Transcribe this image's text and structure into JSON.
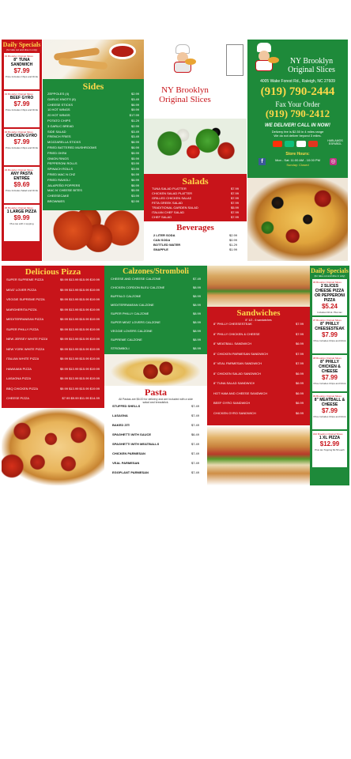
{
  "brand": {
    "name_line1": "NY Brooklyn",
    "name_line2": "Original Slices",
    "address": "4005 Wake Forest Rd., Raleigh, NC 27609",
    "phone": "(919) 790-2444",
    "fax_label": "Fax Your Order",
    "fax": "(919) 790-2412",
    "delivery_title": "WE DELIVER! CALL IN NOW!",
    "delivery_line1": "Delivery fee is $2.50 in 4 miles range",
    "delivery_line2": "We do not deliver beyond 3 miles.",
    "hours_title": "Store Hours:",
    "hours_weekday": "Mon - Sat: 11:00 AM - 10:00 PM",
    "hours_sunday": "Sunday: Closed",
    "spanish": "HABLAMOS ESPAÑOL"
  },
  "daily_specials_left": {
    "title": "Daily Specials",
    "subtitle": "(for take out and dine in only)",
    "items": [
      {
        "tag": "#1 Brooklyn Original Slices",
        "name": "8\" TUNA SANDWICH",
        "price": "$7.99",
        "note": "Price Includes Chips and Drink"
      },
      {
        "tag": "#2 Brooklyn Original Slices",
        "name": "BEEF GYRO",
        "price": "$7.99",
        "note": "Price Includes Chips and Drink"
      },
      {
        "tag": "#3 Brooklyn Original Slices",
        "name": "CHICKEN GYRO",
        "price": "$7.99",
        "note": "Price Includes Chips and Drink"
      },
      {
        "tag": "#4 Brooklyn Original Slices",
        "name": "ANY PASTA ENTRÉE",
        "price": "$9.69",
        "note": "Price Includes Salad and Drink"
      },
      {
        "tag": "#5 Brooklyn Original Slices",
        "name": "1 LARGE PIZZA",
        "price": "$9.99",
        "note": "Plus tax with 1 topping"
      }
    ]
  },
  "daily_specials_right": {
    "title": "Daily Specials",
    "subtitle": "(for take out and dine in only)",
    "items": [
      {
        "tag": "#6 Brooklyn Original Slices",
        "name": "2 SLICES CHEESE PIZZA OR PEPPERONI PIZZA",
        "price": "$5.24",
        "note": "Includes Drink. Plus tax"
      },
      {
        "tag": "#7 Brooklyn Original Slices",
        "name": "8\" PHILLY CHEESESTEAK",
        "price": "$7.99",
        "note": "Price Includes Chips and Drink"
      },
      {
        "tag": "#8 Brooklyn Original Slices",
        "name": "8\" PHILLY CHICKEN & CHEESE",
        "price": "$7.99",
        "note": "Price Includes Chips and Drink"
      },
      {
        "tag": "#9 Brooklyn Original Slices",
        "name": "8\" MEATBALL & CHEESE",
        "price": "$7.99",
        "note": "Price Includes Chips and Drink"
      },
      {
        "tag": "#10 Brooklyn Original Slices",
        "name": "1 XL PIZZA",
        "price": "$12.99",
        "note": "Plus tax Topping $1.50 each"
      }
    ]
  },
  "sides": {
    "title": "Sides",
    "items": [
      {
        "name": "ZEPPOLES (4)",
        "price": "$2.99"
      },
      {
        "name": "GARLIC KNOTS (6)",
        "price": "$3.49"
      },
      {
        "name": "CHEESE STICKS",
        "price": "$6.99"
      },
      {
        "name": "10 HOT WINGS",
        "price": "$9.99"
      },
      {
        "name": "20 HOT WINGS",
        "price": "$17.99"
      },
      {
        "name": "POTATO CHIPS",
        "price": "$1.29"
      },
      {
        "name": "3 GARLIC BREAD",
        "price": "$2.99"
      },
      {
        "name": "SIDE SALAD",
        "price": "$3.49"
      },
      {
        "name": "FRENCH FRIES",
        "price": "$3.49"
      },
      {
        "name": "MOZZARELLA STICKS",
        "price": "$6.99"
      },
      {
        "name": "FRIED BATTERED MUSHROOMS",
        "price": "$6.99"
      },
      {
        "name": "FRIED OKRA",
        "price": "$5.99"
      },
      {
        "name": "ONION RINGS",
        "price": "$5.99"
      },
      {
        "name": "PEPPERONI ROLLS",
        "price": "$3.99"
      },
      {
        "name": "SPINACH ROLLS",
        "price": "$3.99"
      },
      {
        "name": "FRIED MAC N CHZ",
        "price": "$4.99"
      },
      {
        "name": "FRIED RAVIOLI",
        "price": "$6.99"
      },
      {
        "name": "JALAPEÑO POPPERS",
        "price": "$6.99"
      },
      {
        "name": "MAC N' CHEESE BITES",
        "price": "$5.99"
      },
      {
        "name": "CHEESECAKE",
        "price": "$3.99"
      },
      {
        "name": "BROWNIES",
        "price": "$2.99"
      }
    ]
  },
  "salads": {
    "title": "Salads",
    "items": [
      {
        "name": "TUNA SALAD PLATTER",
        "price": "$7.99"
      },
      {
        "name": "CHICKEN SALAD PLATTER",
        "price": "$7.99"
      },
      {
        "name": "GRILLED CHICKEN SALAD",
        "price": "$7.99"
      },
      {
        "name": "FETA GREEK SALAD",
        "price": "$7.99"
      },
      {
        "name": "TRADITIONAL GARDEN SALAD",
        "price": "$5.99"
      },
      {
        "name": "ITALIAN CHEF SALAD",
        "price": "$7.99"
      },
      {
        "name": "CHEF SALAD",
        "price": "$7.99"
      }
    ]
  },
  "beverages": {
    "title": "Beverages",
    "items": [
      {
        "name": "2 LITER SODA",
        "price": "$2.99"
      },
      {
        "name": "CAN SODA",
        "price": "$0.99"
      },
      {
        "name": "BOTTLED WATER",
        "price": "$1.29"
      },
      {
        "name": "SNAPPLE",
        "price": "$1.99"
      }
    ]
  },
  "pizza": {
    "title": "Delicious Pizza",
    "items": [
      {
        "name": "SUPER SUPREME PIZZA",
        "prices": "$9.99 $13.99 $15.99 $19.99"
      },
      {
        "name": "MEAT LOVER PIZZA",
        "prices": "$9.99 $13.99 $15.99 $19.99"
      },
      {
        "name": "VEGGIE SUPREME PIZZA",
        "prices": "$9.99 $13.99 $15.99 $19.99"
      },
      {
        "name": "MARGHERITA PIZZA",
        "prices": "$9.99 $13.99 $15.99 $19.99"
      },
      {
        "name": "MEDITERRANEAN PIZZA",
        "prices": "$9.99 $13.99 $15.99 $19.99"
      },
      {
        "name": "SUPER PHILLY PIZZA",
        "prices": "$9.99 $13.99 $15.99 $19.99"
      },
      {
        "name": "NEW JERSEY WHITE PIZZA",
        "prices": "$9.99 $13.99 $15.99 $19.99"
      },
      {
        "name": "NEW YORK WHITE PIZZA",
        "prices": "$9.99 $13.99 $15.99 $19.99"
      },
      {
        "name": "ITALIAN WHITE PIZZA",
        "prices": "$9.99 $13.99 $15.99 $19.99"
      },
      {
        "name": "HAWAIIAN PIZZA",
        "prices": "$9.99 $13.99 $15.99 $19.99"
      },
      {
        "name": "LASAGNA PIZZA",
        "prices": "$9.99 $13.99 $15.99 $19.99"
      },
      {
        "name": "BBQ CHICKEN PIZZA",
        "prices": "$9.99 $13.99 $15.99 $19.99"
      },
      {
        "name": "CHEESE PIZZA",
        "prices": "$7.99 $9.99 $11.99 $14.99"
      }
    ]
  },
  "calzones": {
    "title": "Calzones/Stromboli",
    "items": [
      {
        "name": "CHEESE AND CHEESE CALZONE",
        "price": "$7.49"
      },
      {
        "name": "CHICKEN CORDON BLEU CALZONE",
        "price": "$8.99"
      },
      {
        "name": "BUFFALO CALZONE",
        "price": "$8.99"
      },
      {
        "name": "MEDITERRANEAN CALZONE",
        "price": "$8.99"
      },
      {
        "name": "SUPER PHILLY CALZONE",
        "price": "$8.99"
      },
      {
        "name": "SUPER MEAT LOVERS CALZONE",
        "price": "$8.99"
      },
      {
        "name": "VEGGIE LOVERS CALZONE",
        "price": "$8.99"
      },
      {
        "name": "SUPREME CALZONE",
        "price": "$8.99"
      },
      {
        "name": "STROMBOLI",
        "price": "$8.99"
      }
    ]
  },
  "pasta": {
    "title": "Pasta",
    "note": "All Pastas are $6.00 for delivery and are included with a side salad and breadstick.",
    "items": [
      {
        "name": "STUFFED SHELLS",
        "price": "$7.49"
      },
      {
        "name": "LASAGNA",
        "price": "$7.49"
      },
      {
        "name": "BAKED ZITI",
        "price": "$7.49"
      },
      {
        "name": "SPAGHETTI WITH SAUCE",
        "price": "$6.49"
      },
      {
        "name": "SPAGHETTI WITH MEATBALLS",
        "price": "$7.49"
      },
      {
        "name": "CHICKEN PARMESAN",
        "price": "$7.49"
      },
      {
        "name": "VEAL PARMESAN",
        "price": "$7.49"
      },
      {
        "name": "EGGPLANT PARMESAN",
        "price": "$7.49"
      }
    ]
  },
  "sandwiches": {
    "title": "Sandwiches",
    "subtitle": "8\" 1/2 - 6 sandwiches",
    "items": [
      {
        "name": "8\" PHILLY CHEESESTEAK",
        "price": "$7.99"
      },
      {
        "name": "8\" PHILLY CHICKEN & CHEESE",
        "price": "$7.99"
      },
      {
        "name": "8\" MEATBALL SANDWICH",
        "price": "$6.99"
      },
      {
        "name": "8\" CHICKEN PARMESAN SANDWICH",
        "price": "$7.99"
      },
      {
        "name": "8\" VEAL PARMESAN SANDWICH",
        "price": "$7.99"
      },
      {
        "name": "8\" CHICKEN SALAD SANDWICH",
        "price": "$6.99"
      },
      {
        "name": "8\" TUNA SALAD SANDWICH",
        "price": "$6.99"
      },
      {
        "name": "HOT HAM AND CHEESE SANDWICH",
        "price": "$6.99"
      },
      {
        "name": "BEEF GYRO SANDWICH",
        "price": "$6.99"
      },
      {
        "name": "CHICKEN GYRO SANDWICH",
        "price": "$6.99"
      }
    ]
  },
  "social": {
    "facebook": "f",
    "instagram": "◎"
  },
  "colors": {
    "red": "#c8141a",
    "green": "#1e8a3a",
    "gold": "#ffd84a"
  }
}
